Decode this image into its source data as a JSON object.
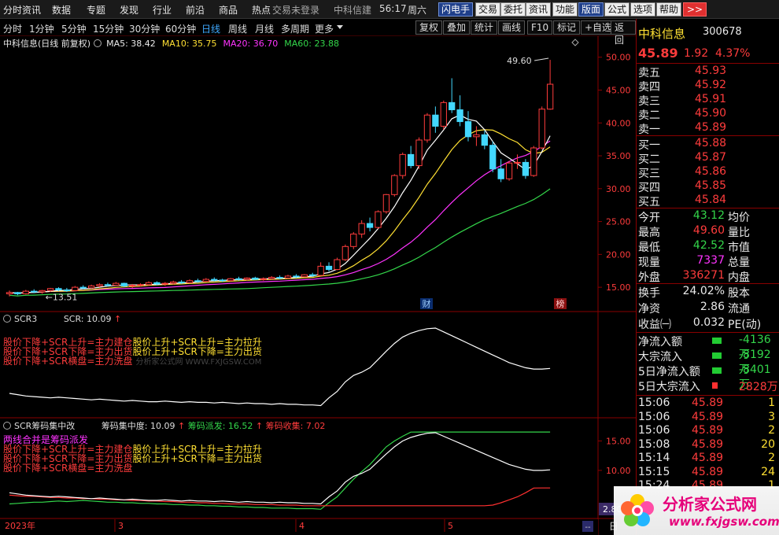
{
  "menu": {
    "items": [
      "分时",
      "资讯",
      "数据",
      "专题",
      "发现",
      "行业",
      "前沿",
      "商品",
      "热点"
    ],
    "login_status": "交易未登录",
    "clock_label": "中科信建",
    "clock": "56:17",
    "weekday": "周六",
    "tools": [
      "闪电手",
      "交易",
      "委托",
      "资讯",
      "功能",
      "版面",
      "公式",
      "选项",
      "帮助"
    ],
    "more_icon": ">>"
  },
  "periods": {
    "items": [
      "分时",
      "1分钟",
      "5分钟",
      "15分钟",
      "30分钟",
      "60分钟",
      "日线",
      "周线",
      "月线",
      "多周期",
      "更多"
    ],
    "active": "日线",
    "buttons": [
      "复权",
      "叠加",
      "统计",
      "画线",
      "F10",
      "标记",
      "+自选",
      "返回"
    ]
  },
  "main_legend": {
    "title": "中科信息(日线 前复权)",
    "ma5": "MA5: 38.42",
    "ma10": "MA10: 35.75",
    "ma20": "MA20: 36.70",
    "ma60": "MA60: 23.88"
  },
  "annotations": {
    "high_label": "49.60",
    "low_label": "13.51",
    "badge_cai": "财",
    "badge_bang": "榜"
  },
  "price_axis": [
    "50.00",
    "45.00",
    "40.00",
    "35.00",
    "30.00",
    "25.00",
    "20.00",
    "15.00"
  ],
  "scr_axis": [],
  "chip_axis": [
    "15.00",
    "10.00"
  ],
  "bottom_value": "2.80",
  "date_axis": {
    "year": "2023年",
    "ticks": [
      "3",
      "4",
      "5"
    ]
  },
  "scr3": {
    "title": "SCR3",
    "value": "SCR: 10.09",
    "watermark": "分析家公式网 WWW.FXJGSW.COM",
    "lines": [
      {
        "left": "股价下降+SCR上升=主力建仓",
        "right": "股价上升+SCR上升=主力拉升"
      },
      {
        "left": "股价下降+SCR下降=主力出货",
        "right": "股价上升+SCR下降=主力出货"
      },
      {
        "left": "股价下降+SCR横盘=主力洗盘",
        "right": ""
      }
    ]
  },
  "chip": {
    "title": "SCR筹码集中改",
    "conc": "筹码集中度: 10.09",
    "dispatch": "筹码派发: 16.52",
    "collect": "筹码收集: 7.02",
    "note": "两线合并是筹码派发",
    "lines": [
      {
        "left": "股价下降+SCR上升=主力建仓",
        "right": "股价上升+SCR上升=主力拉升"
      },
      {
        "left": "股价下降+SCR下降=主力出货",
        "right": "股价上升+SCR下降=主力出货"
      },
      {
        "left": "股价下降+SCR横盘=主力洗盘",
        "right": ""
      }
    ]
  },
  "quote": {
    "name": "中科信息",
    "code": "300678",
    "price": "45.89",
    "change": "1.92",
    "pct": "4.37%",
    "asks": [
      {
        "label": "卖五",
        "price": "45.93"
      },
      {
        "label": "卖四",
        "price": "45.92"
      },
      {
        "label": "卖三",
        "price": "45.91"
      },
      {
        "label": "卖二",
        "price": "45.90"
      },
      {
        "label": "卖一",
        "price": "45.89"
      }
    ],
    "bids": [
      {
        "label": "买一",
        "price": "45.88"
      },
      {
        "label": "买二",
        "price": "45.87"
      },
      {
        "label": "买三",
        "price": "45.86"
      },
      {
        "label": "买四",
        "price": "45.85"
      },
      {
        "label": "买五",
        "price": "45.84"
      }
    ],
    "stats": [
      {
        "label": "今开",
        "value": "43.12",
        "label2": "均价",
        "cls": "green"
      },
      {
        "label": "最高",
        "value": "49.60",
        "label2": "量比",
        "cls": "red"
      },
      {
        "label": "最低",
        "value": "42.52",
        "label2": "市值",
        "cls": "green"
      },
      {
        "label": "现量",
        "value": "7337",
        "label2": "总量",
        "cls": "magenta"
      },
      {
        "label": "外盘",
        "value": "336271",
        "label2": "内盘",
        "cls": "red"
      }
    ],
    "stats2": [
      {
        "label": "换手",
        "value": "24.02%",
        "label2": "股本"
      },
      {
        "label": "净资",
        "value": "2.86",
        "label2": "流通"
      },
      {
        "label": "收益㈠",
        "value": "0.032",
        "label2": "PE(动)"
      }
    ],
    "flows": [
      {
        "label": "净流入额",
        "value": "-4136万",
        "cls": "green"
      },
      {
        "label": "大宗流入",
        "value": "-8192万",
        "cls": "green"
      },
      {
        "label": "5日净流入额",
        "value": "-8401万",
        "cls": "green"
      },
      {
        "label": "5日大宗流入",
        "value": "2828万",
        "cls": "red"
      }
    ],
    "ticks": [
      {
        "time": "15:06",
        "price": "45.89",
        "vol": "1"
      },
      {
        "time": "15:06",
        "price": "45.89",
        "vol": "3"
      },
      {
        "time": "15:06",
        "price": "45.89",
        "vol": "2"
      },
      {
        "time": "15:08",
        "price": "45.89",
        "vol": "20"
      },
      {
        "time": "15:14",
        "price": "45.89",
        "vol": "2"
      },
      {
        "time": "15:15",
        "price": "45.89",
        "vol": "24"
      },
      {
        "time": "15:24",
        "price": "45.89",
        "vol": "1"
      }
    ],
    "day_label": "日"
  },
  "logo": {
    "text": "分析家公式网",
    "url": "www.fxjgsw.com"
  },
  "chart_data": {
    "type": "candlestick",
    "title": "中科信息(日线 前复权)",
    "price_range": [
      13.5,
      49.6
    ],
    "candles": [
      [
        14.0,
        14.5,
        13.6,
        14.2
      ],
      [
        14.2,
        14.3,
        13.8,
        14.0
      ],
      [
        14.0,
        14.6,
        13.9,
        14.4
      ],
      [
        14.4,
        14.7,
        14.1,
        14.3
      ],
      [
        14.3,
        14.6,
        14.0,
        14.5
      ],
      [
        14.5,
        14.9,
        14.3,
        14.8
      ],
      [
        14.8,
        15.0,
        14.4,
        14.6
      ],
      [
        14.6,
        14.9,
        14.3,
        14.5
      ],
      [
        14.5,
        15.2,
        14.4,
        15.0
      ],
      [
        15.0,
        15.3,
        14.7,
        14.9
      ],
      [
        14.9,
        15.4,
        14.8,
        15.2
      ],
      [
        15.2,
        15.6,
        15.0,
        15.4
      ],
      [
        15.4,
        15.7,
        15.1,
        15.3
      ],
      [
        15.3,
        15.8,
        15.2,
        15.6
      ],
      [
        15.6,
        15.7,
        15.0,
        15.2
      ],
      [
        15.2,
        15.5,
        14.9,
        15.3
      ],
      [
        15.3,
        15.6,
        15.1,
        15.4
      ],
      [
        15.4,
        15.9,
        15.2,
        15.7
      ],
      [
        15.7,
        15.9,
        15.3,
        15.5
      ],
      [
        15.5,
        15.8,
        15.2,
        15.6
      ],
      [
        15.6,
        16.0,
        15.4,
        15.8
      ],
      [
        15.8,
        16.1,
        15.5,
        15.7
      ],
      [
        15.7,
        16.2,
        15.6,
        16.0
      ],
      [
        16.0,
        16.3,
        15.7,
        15.9
      ],
      [
        15.9,
        16.4,
        15.8,
        16.2
      ],
      [
        16.2,
        16.5,
        15.9,
        16.1
      ],
      [
        16.1,
        16.3,
        15.8,
        16.0
      ],
      [
        16.0,
        16.4,
        15.9,
        16.3
      ],
      [
        16.3,
        16.6,
        16.0,
        16.2
      ],
      [
        16.2,
        16.5,
        16.0,
        16.4
      ],
      [
        16.4,
        16.6,
        16.1,
        16.2
      ],
      [
        16.2,
        16.5,
        16.0,
        16.3
      ],
      [
        16.3,
        16.7,
        16.2,
        16.5
      ],
      [
        16.5,
        16.8,
        16.2,
        16.4
      ],
      [
        16.4,
        16.9,
        16.3,
        16.7
      ],
      [
        16.7,
        17.0,
        16.4,
        16.6
      ],
      [
        16.6,
        17.0,
        16.5,
        16.9
      ],
      [
        16.9,
        17.2,
        16.6,
        16.8
      ],
      [
        16.8,
        18.8,
        16.7,
        18.2
      ],
      [
        18.2,
        18.8,
        17.4,
        17.7
      ],
      [
        17.7,
        19.5,
        17.6,
        19.2
      ],
      [
        19.2,
        21.5,
        19.0,
        21.2
      ],
      [
        21.2,
        23.4,
        20.8,
        23.1
      ],
      [
        23.1,
        25.2,
        22.5,
        24.7
      ],
      [
        24.7,
        25.6,
        23.5,
        24.1
      ],
      [
        24.1,
        26.7,
        23.9,
        26.5
      ],
      [
        26.5,
        29.2,
        26.2,
        29.1
      ],
      [
        29.1,
        32.2,
        28.8,
        32.0
      ],
      [
        32.0,
        35.5,
        31.5,
        35.2
      ],
      [
        35.2,
        36.5,
        33.1,
        33.5
      ],
      [
        33.5,
        37.8,
        33.0,
        37.4
      ],
      [
        37.4,
        41.5,
        37.0,
        41.2
      ],
      [
        41.2,
        42.5,
        38.5,
        39.5
      ],
      [
        39.5,
        43.4,
        39.0,
        43.1
      ],
      [
        43.1,
        46.8,
        41.5,
        42.0
      ],
      [
        42.0,
        44.2,
        39.5,
        40.2
      ],
      [
        40.2,
        41.8,
        37.2,
        37.9
      ],
      [
        37.9,
        39.5,
        36.5,
        38.2
      ],
      [
        38.2,
        38.8,
        36.0,
        36.6
      ],
      [
        36.6,
        37.2,
        32.5,
        33.0
      ],
      [
        33.0,
        34.5,
        31.0,
        31.5
      ],
      [
        31.5,
        34.2,
        31.2,
        33.9
      ],
      [
        33.9,
        35.2,
        33.0,
        34.0
      ],
      [
        34.0,
        34.5,
        31.5,
        32.0
      ],
      [
        32.0,
        36.5,
        31.8,
        36.2
      ],
      [
        36.2,
        42.5,
        36.0,
        42.1
      ],
      [
        42.1,
        49.6,
        42.0,
        45.89
      ]
    ],
    "ma5_last": 38.42,
    "ma10_last": 35.75,
    "ma20_last": 36.7,
    "ma60_last": 23.88,
    "scr3": [
      6.2,
      6.0,
      5.8,
      5.7,
      5.6,
      5.5,
      5.6,
      5.5,
      5.4,
      5.3,
      5.2,
      5.3,
      5.2,
      5.1,
      5.0,
      5.1,
      5.0,
      4.9,
      4.9,
      5.0,
      4.9,
      4.8,
      4.9,
      4.8,
      4.8,
      4.7,
      4.8,
      4.7,
      4.6,
      4.7,
      4.6,
      4.6,
      4.5,
      4.6,
      4.5,
      4.5,
      4.4,
      4.4,
      4.3,
      5.5,
      6.5,
      8.0,
      9.0,
      9.5,
      10.2,
      11.5,
      12.8,
      14.0,
      15.0,
      15.6,
      16.0,
      16.3,
      16.4,
      15.8,
      15.2,
      14.6,
      14.0,
      13.4,
      12.8,
      12.2,
      11.6,
      11.0,
      10.6,
      10.2,
      10.0,
      10.0,
      10.09
    ],
    "chip_dispatch": [
      4.3,
      4.4,
      4.5,
      4.6,
      4.6,
      4.7,
      4.8,
      4.7,
      4.8,
      4.9,
      4.8,
      4.7,
      4.6,
      4.6,
      4.5,
      4.5,
      4.4,
      4.4,
      4.3,
      4.3,
      4.2,
      4.2,
      4.1,
      4.1,
      4.0,
      4.0,
      3.9,
      3.9,
      3.8,
      3.8,
      3.7,
      3.7,
      3.6,
      3.6,
      3.6,
      3.5,
      3.5,
      3.5,
      3.4,
      4.5,
      5.5,
      7.0,
      8.5,
      9.8,
      11.0,
      12.5,
      14.0,
      15.0,
      15.8,
      16.5,
      16.52,
      16.52,
      16.52,
      16.52,
      16.52,
      16.52,
      16.52,
      16.52,
      16.52,
      16.52,
      16.52,
      16.52,
      16.52,
      16.52,
      16.52,
      16.52,
      16.52
    ],
    "chip_collect": [
      5.8,
      5.7,
      5.6,
      5.6,
      5.5,
      5.4,
      5.4,
      5.3,
      5.3,
      5.2,
      5.2,
      5.1,
      5.1,
      5.0,
      5.0,
      4.9,
      4.9,
      4.8,
      4.8,
      4.7,
      4.7,
      4.6,
      4.6,
      4.5,
      4.5,
      4.4,
      4.4,
      4.3,
      4.3,
      4.3,
      4.2,
      4.2,
      4.2,
      4.1,
      4.1,
      4.1,
      4.0,
      4.0,
      4.0,
      4.0,
      4.0,
      4.0,
      4.0,
      4.0,
      4.0,
      4.0,
      4.0,
      4.0,
      4.0,
      4.0,
      4.0,
      4.0,
      4.0,
      4.0,
      4.0,
      4.0,
      4.0,
      4.0,
      4.0,
      4.1,
      4.5,
      5.0,
      5.5,
      6.2,
      7.0,
      7.02,
      7.02
    ],
    "chip_conc": [
      6.2,
      6.0,
      5.8,
      5.7,
      5.6,
      5.5,
      5.6,
      5.5,
      5.4,
      5.3,
      5.2,
      5.3,
      5.2,
      5.1,
      5.0,
      5.1,
      5.0,
      4.9,
      4.9,
      5.0,
      4.9,
      4.8,
      4.9,
      4.8,
      4.8,
      4.7,
      4.8,
      4.7,
      4.6,
      4.7,
      4.6,
      4.6,
      4.5,
      4.6,
      4.5,
      4.5,
      4.4,
      4.4,
      4.3,
      5.5,
      6.5,
      8.0,
      9.0,
      9.5,
      10.2,
      11.5,
      12.8,
      14.0,
      15.0,
      15.6,
      16.0,
      16.3,
      16.4,
      15.8,
      15.2,
      14.6,
      14.0,
      13.4,
      12.8,
      12.2,
      11.6,
      11.0,
      10.6,
      10.2,
      10.0,
      10.0,
      10.09
    ]
  }
}
